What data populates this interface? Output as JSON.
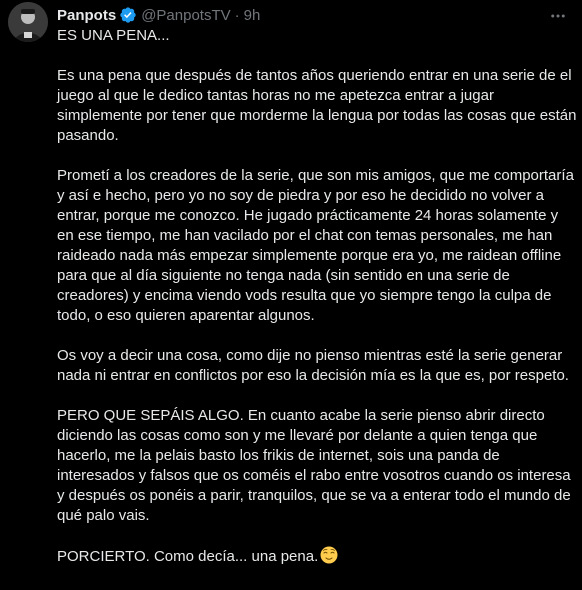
{
  "tweet": {
    "author_name": "Panpots",
    "handle": "@PanpotsTV",
    "separator": "·",
    "time": "9h",
    "icons": {
      "verified": "verified-badge-icon",
      "more": "more-horizontal-icon",
      "avatar": "avatar-image"
    },
    "colors": {
      "background": "#000000",
      "text": "#e7e9ea",
      "secondary_text": "#71767b",
      "verified_badge": "#1d9bf0"
    },
    "paragraphs": [
      "ES UNA PENA...",
      "Es una pena que después de tantos años queriendo entrar en una serie de el juego al que le dedico tantas horas no me apetezca entrar a jugar simplemente por tener que morderme la lengua por todas las cosas que están pasando.",
      "Prometí a los creadores de la serie, que son mis amigos, que me comportaría y así e hecho, pero yo no soy de piedra y por eso he decidido no volver a entrar, porque me conozco. He jugado prácticamente 24 horas solamente y en ese tiempo, me han vacilado por el chat con temas personales, me han raideado nada más empezar simplemente porque era yo, me raidean offline para que al día siguiente no tenga nada (sin sentido en una serie de creadores) y encima viendo vods resulta que yo siempre tengo la culpa de todo, o eso quieren aparentar algunos.",
      "Os voy a decir una cosa, como dije no pienso mientras esté la serie generar nada ni entrar en conflictos por eso la decisión mía es la que es, por respeto.",
      "PERO QUE SEPÁIS ALGO. En cuanto acabe la serie pienso abrir directo diciendo las cosas como son y me llevaré por delante a quien tenga que hacerlo, me la pelais basto los frikis de internet, sois una panda de interesados y falsos que os coméis el rabo entre vosotros cuando os interesa y después os ponéis a parir, tranquilos, que se va a enterar todo el mundo de qué palo vais.",
      "PORCIERTO. Como decía... una pena."
    ],
    "final_emoji": "relieved-face-emoji"
  }
}
